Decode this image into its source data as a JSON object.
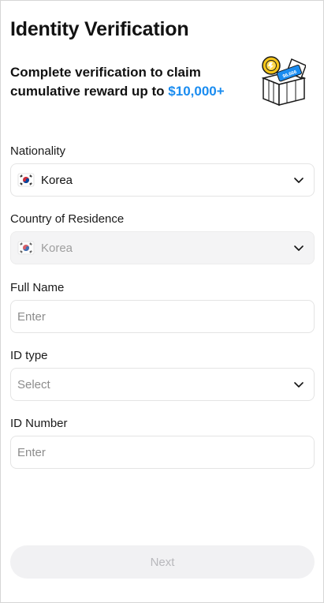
{
  "header": {
    "title": "Identity Verification"
  },
  "promo": {
    "text": "Complete verification to claim cumulative reward up to",
    "amount": "$10,000+",
    "illustration_icon": "reward-box-illustration",
    "ticket_text": "$6,666"
  },
  "nationality": {
    "label": "Nationality",
    "value": "Korea",
    "flag_icon": "korea-flag-icon"
  },
  "residence": {
    "label": "Country of Residence",
    "value": "Korea",
    "flag_icon": "korea-flag-icon",
    "disabled": true
  },
  "full_name": {
    "label": "Full Name",
    "placeholder": "Enter"
  },
  "id_type": {
    "label": "ID type",
    "placeholder": "Select"
  },
  "id_number": {
    "label": "ID Number",
    "placeholder": "Enter"
  },
  "footer": {
    "next_label": "Next"
  },
  "colors": {
    "accent": "#1a8cf0",
    "disabled_bg": "#f4f4f5",
    "button_disabled_bg": "#f1f1f3",
    "button_disabled_text": "#b8b8bc"
  }
}
